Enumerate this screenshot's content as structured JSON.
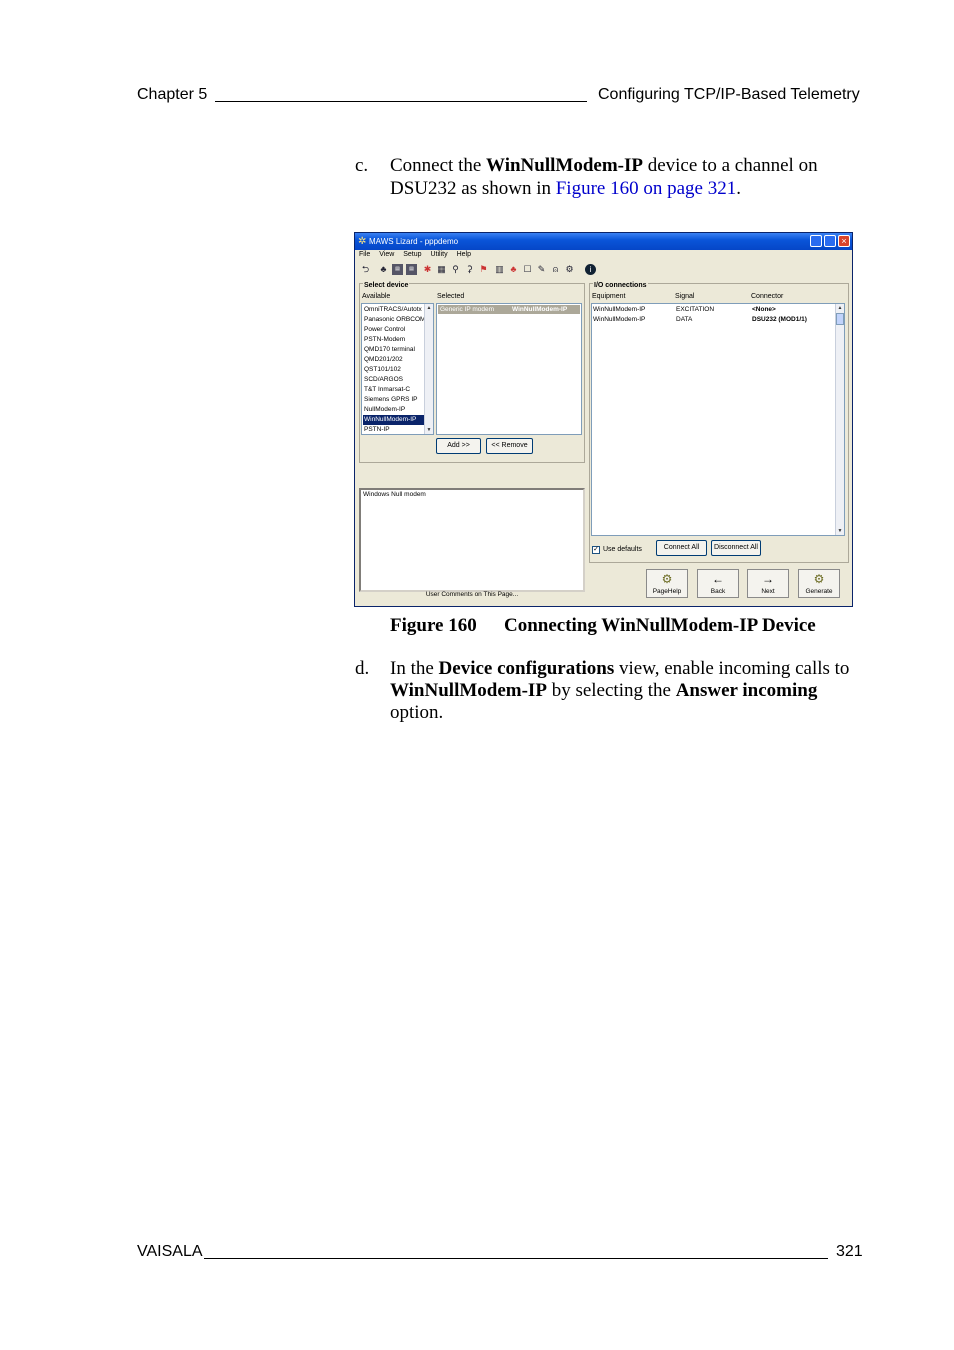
{
  "header": {
    "chapter": "Chapter 5",
    "title": "Configuring TCP/IP-Based Telemetry"
  },
  "step_c": {
    "marker": "c.",
    "text_1": "Connect the ",
    "bold_1": "WinNullModem-IP",
    "text_2": " device to a channel on",
    "text_3": "DSU232 as shown in ",
    "link": "Figure 160 on page 321",
    "text_4": "."
  },
  "screenshot": {
    "window_title": "MAWS Lizard - pppdemo",
    "menu": [
      "File",
      "View",
      "Setup",
      "Utility",
      "Help"
    ],
    "select_device": {
      "group_label": "Select device",
      "available_label": "Available",
      "selected_label": "Selected",
      "available_items": [
        "OmniTRACS/Autotx",
        "Panasonic ORBCOM",
        "Power Control",
        "PSTN-Modem",
        "QMD170 terminal",
        "QMD201/202",
        "QST101/102",
        "SCD/ARGOS",
        "T&T Inmarsat-C",
        "Siemens GPRS IP",
        "NullModem-IP",
        "WinNullModem-IP",
        "PSTN-IP"
      ],
      "available_selected_index": 11,
      "selected_type": "Generic IP modem",
      "selected_name": "WinNullModem-IP",
      "add_button": "Add >>",
      "remove_button": "<< Remove"
    },
    "comment_text": "Windows Null modem",
    "user_comments_label": "User Comments on This Page...",
    "io": {
      "group_label": "I/O connections",
      "col_equipment": "Equipment",
      "col_signal": "Signal",
      "col_connector": "Connector",
      "rows": [
        {
          "equipment": "WinNullModem-IP",
          "signal": "EXCITATION",
          "connector": "<None>"
        },
        {
          "equipment": "WinNullModem-IP",
          "signal": "DATA",
          "connector": "DSU232 (MOD1/1)"
        }
      ],
      "use_defaults_label": "Use defaults",
      "use_defaults_checked": true,
      "connect_all": "Connect All",
      "disconnect_all": "Disconnect All"
    },
    "nav_buttons": [
      {
        "label": "PageHelp",
        "icon": "help-gear-icon",
        "glyph": "⚙"
      },
      {
        "label": "Back",
        "icon": "arrow-left-icon",
        "glyph": "←"
      },
      {
        "label": "Next",
        "icon": "arrow-right-icon",
        "glyph": "→"
      },
      {
        "label": "Generate",
        "icon": "generate-gears-icon",
        "glyph": "⚙"
      }
    ]
  },
  "figure": {
    "number": "Figure 160",
    "caption": "Connecting WinNullModem-IP Device"
  },
  "step_d": {
    "marker": "d.",
    "text_1": "In the ",
    "bold_1": "Device configurations",
    "text_2": " view, enable incoming calls to",
    "bold_2": "WinNullModem-IP",
    "text_3": " by selecting the ",
    "bold_3": "Answer incoming",
    "text_4": "option."
  },
  "footer": {
    "company": "VAISALA",
    "page": "321"
  }
}
